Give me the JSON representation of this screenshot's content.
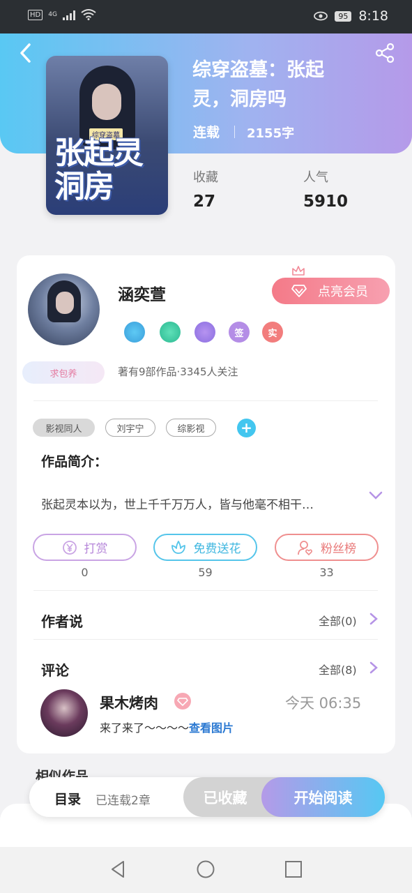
{
  "status_bar": {
    "hd": "HD",
    "network": "4G",
    "battery": "95",
    "time": "8:18"
  },
  "book": {
    "title": "综穿盗墓：张起灵，洞房吗",
    "status": "连载",
    "words": "2155字",
    "cover_tag": "综穿盗墓",
    "cover_title": "张起灵洞房",
    "stats": [
      {
        "label": "收藏",
        "value": "27"
      },
      {
        "label": "人气",
        "value": "5910"
      }
    ]
  },
  "author": {
    "name": "涵奕萱",
    "vip_button": "点亮会员",
    "qiubao": "求包养",
    "badges": [
      {
        "icon": "music-badge-icon",
        "text": ""
      },
      {
        "icon": "handshake-badge-icon",
        "text": ""
      },
      {
        "icon": "ticket-badge-icon",
        "text": ""
      },
      {
        "icon": "sign-badge-icon",
        "text": "签"
      },
      {
        "icon": "verified-badge-icon",
        "text": "实"
      }
    ],
    "meta": "著有9部作品·3345人关注"
  },
  "tags": [
    "影视同人",
    "刘宇宁",
    "综影视"
  ],
  "intro": {
    "label": "作品简介：",
    "text": "张起灵本以为，世上千千万万人，皆与他毫不相干…"
  },
  "actions": [
    {
      "label": "打赏",
      "count": "0",
      "color": "#c79ae0"
    },
    {
      "label": "免费送花",
      "count": "59",
      "color": "#4ec3e8"
    },
    {
      "label": "粉丝榜",
      "count": "33",
      "color": "#ef8a8a"
    }
  ],
  "author_says": {
    "title": "作者说",
    "more": "全部(0)"
  },
  "comments": {
    "title": "评论",
    "more": "全部(8)",
    "item": {
      "name": "果木烤肉",
      "time": "今天 06:35",
      "text": "来了来了～～～～",
      "link": "查看图片"
    }
  },
  "similar_title": "相似作品",
  "bottom": {
    "toc": "目录",
    "toc_meta": "已连载2章",
    "saved": "已收藏",
    "read": "开始阅读"
  }
}
